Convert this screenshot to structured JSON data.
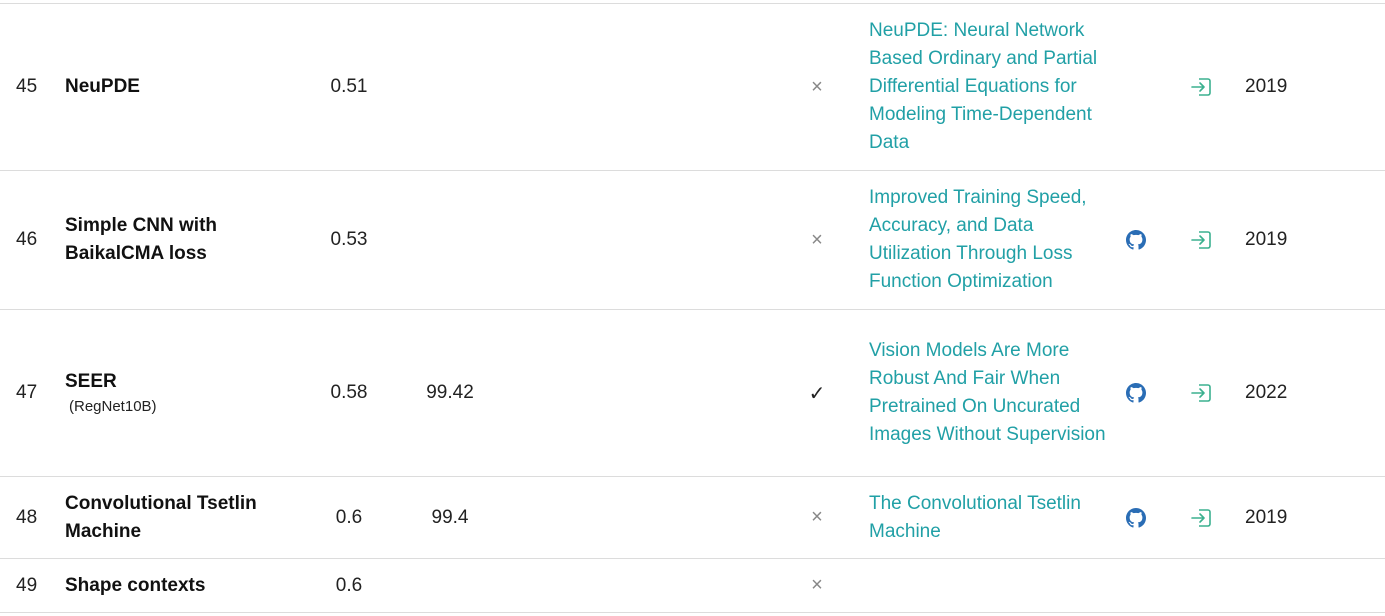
{
  "rows": [
    {
      "rank": "45",
      "model": "NeuPDE",
      "model_sub": "",
      "error": "0.51",
      "accuracy": "",
      "extra": "×",
      "extra_state": "no",
      "paper": "NeuPDE: Neural Network Based Ordinary and Partial Differential Equations for Modeling Time-Dependent Data",
      "has_code": false,
      "year": "2019"
    },
    {
      "rank": "46",
      "model": "Simple CNN with BaikalCMA loss",
      "model_sub": "",
      "error": "0.53",
      "accuracy": "",
      "extra": "×",
      "extra_state": "no",
      "paper": "Improved Training Speed, Accuracy, and Data Utilization Through Loss Function Optimization",
      "has_code": true,
      "year": "2019"
    },
    {
      "rank": "47",
      "model": "SEER",
      "model_sub": "(RegNet10B)",
      "error": "0.58",
      "accuracy": "99.42",
      "extra": "✓",
      "extra_state": "yes",
      "paper": "Vision Models Are More Robust And Fair When Pretrained On Uncurated Images Without Supervision",
      "has_code": true,
      "year": "2022"
    },
    {
      "rank": "48",
      "model": "Convolutional Tsetlin Machine",
      "model_sub": "",
      "error": "0.6",
      "accuracy": "99.4",
      "extra": "×",
      "extra_state": "no",
      "paper": "The Convolutional Tsetlin Machine",
      "has_code": true,
      "year": "2019"
    },
    {
      "rank": "49",
      "model": "Shape contexts",
      "model_sub": "",
      "error": "0.6",
      "accuracy": "",
      "extra": "×",
      "extra_state": "no",
      "paper": "",
      "has_code": false,
      "year": ""
    }
  ],
  "colors": {
    "link": "#21a0a6",
    "github": "#2a6db5",
    "result_icon": "#3bb08f",
    "border": "#dcdcdc"
  }
}
